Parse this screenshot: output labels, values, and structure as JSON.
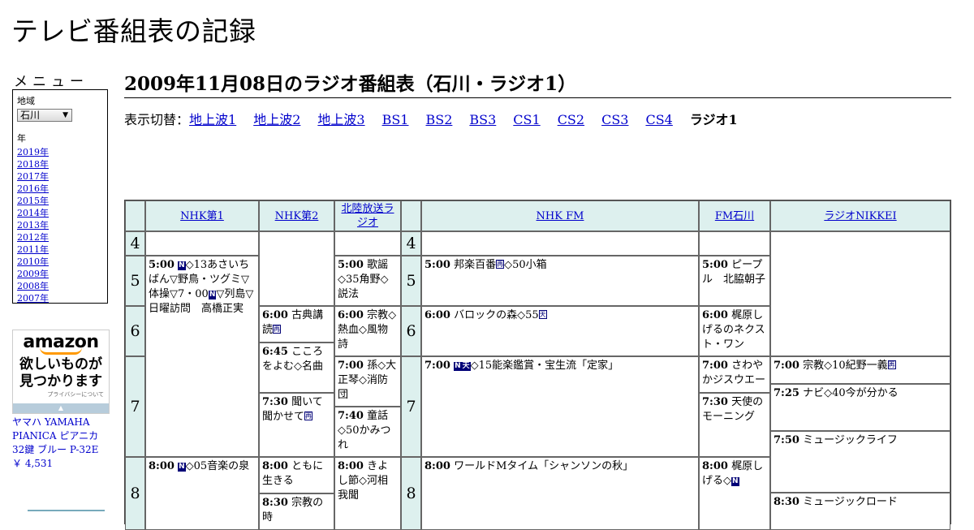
{
  "site_title": "テレビ番組表の記録",
  "menu": {
    "title": "メニュー",
    "region_label": "地域",
    "region_value": "石川",
    "year_label": "年",
    "years": [
      "2019年",
      "2018年",
      "2017年",
      "2016年",
      "2015年",
      "2014年",
      "2013年",
      "2012年",
      "2011年",
      "2010年",
      "2009年",
      "2008年",
      "2007年"
    ]
  },
  "ad": {
    "logo": "amazon",
    "copy_line1": "欲しいものが",
    "copy_line2": "見つかります",
    "privacy": "プライバシーについて",
    "product_name": "ヤマハ YAMAHA PIANICA ピアニカ 32鍵 ブルー P-32E",
    "product_price": "￥ 4,531"
  },
  "page_title": "2009年11月08日のラジオ番組表（石川・ラジオ1）",
  "switch": {
    "label": "表示切替：",
    "links": [
      "地上波1",
      "地上波2",
      "地上波3",
      "BS1",
      "BS2",
      "BS3",
      "CS1",
      "CS2",
      "CS3",
      "CS4"
    ],
    "current": "ラジオ1"
  },
  "channels": [
    "NHK第1",
    "NHK第2",
    "北陸放送ラジオ",
    "NHK FM",
    "FM石川",
    "ラジオNIKKEI"
  ],
  "hours": [
    "4",
    "5",
    "6",
    "7",
    "8"
  ],
  "programs": {
    "nhk1_500": {
      "time": "5:00",
      "a": "",
      "b": "◇13あさいちばん▽野鳥・ツグミ▽体操▽7・00",
      "c": "▽列島▽日曜訪問　高橋正実"
    },
    "nhk1_800": {
      "time": "8:00",
      "a": "",
      "b": "◇05音楽の泉"
    },
    "nhk2_600": {
      "time": "6:00",
      "a": "古典講読"
    },
    "nhk2_645": {
      "time": "6:45",
      "a": "こころをよむ◇名曲"
    },
    "nhk2_730": {
      "time": "7:30",
      "a": "聞いて聞かせて"
    },
    "nhk2_800": {
      "time": "8:00",
      "a": "ともに生きる"
    },
    "nhk2_830": {
      "time": "8:30",
      "a": "宗教の時"
    },
    "mro_500": {
      "time": "5:00",
      "a": "歌謡◇35角野◇説法"
    },
    "mro_600": {
      "time": "6:00",
      "a": "宗教◇熱血◇風物詩"
    },
    "mro_700": {
      "time": "7:00",
      "a": "孫◇大正琴◇消防団"
    },
    "mro_740": {
      "time": "7:40",
      "a": "童話◇50かみつれ"
    },
    "mro_800": {
      "time": "8:00",
      "a": "きよし節◇河相我聞"
    },
    "fm_500": {
      "time": "5:00",
      "a": "邦楽百番",
      "b": "◇50小箱"
    },
    "fm_600": {
      "time": "6:00",
      "a": "バロックの森◇55"
    },
    "fm_700": {
      "time": "7:00",
      "a": "◇15能楽鑑賞・宝生流「定家」"
    },
    "fm_800": {
      "time": "8:00",
      "a": "ワールドMタイム「シャンソンの秋」"
    },
    "fmi_500": {
      "time": "5:00",
      "a": "ピープル　北脇朝子"
    },
    "fmi_600": {
      "time": "6:00",
      "a": "梶原しげるのネクスト・ワン"
    },
    "fmi_700": {
      "time": "7:00",
      "a": "さわやかジスウエー"
    },
    "fmi_730": {
      "time": "7:30",
      "a": "天使のモーニング"
    },
    "fmi_800": {
      "time": "8:00",
      "a": "梶原しげる◇"
    },
    "nik_700": {
      "time": "7:00",
      "a": "宗教◇10紀野一義"
    },
    "nik_725": {
      "time": "7:25",
      "a": "ナビ◇40今が分かる"
    },
    "nik_750": {
      "time": "7:50",
      "a": "ミュージックライフ"
    },
    "nik_830": {
      "time": "8:30",
      "a": "ミュージックロード"
    }
  },
  "icons": {
    "news": "N",
    "rebroadcast": "再",
    "stereo": "天"
  }
}
